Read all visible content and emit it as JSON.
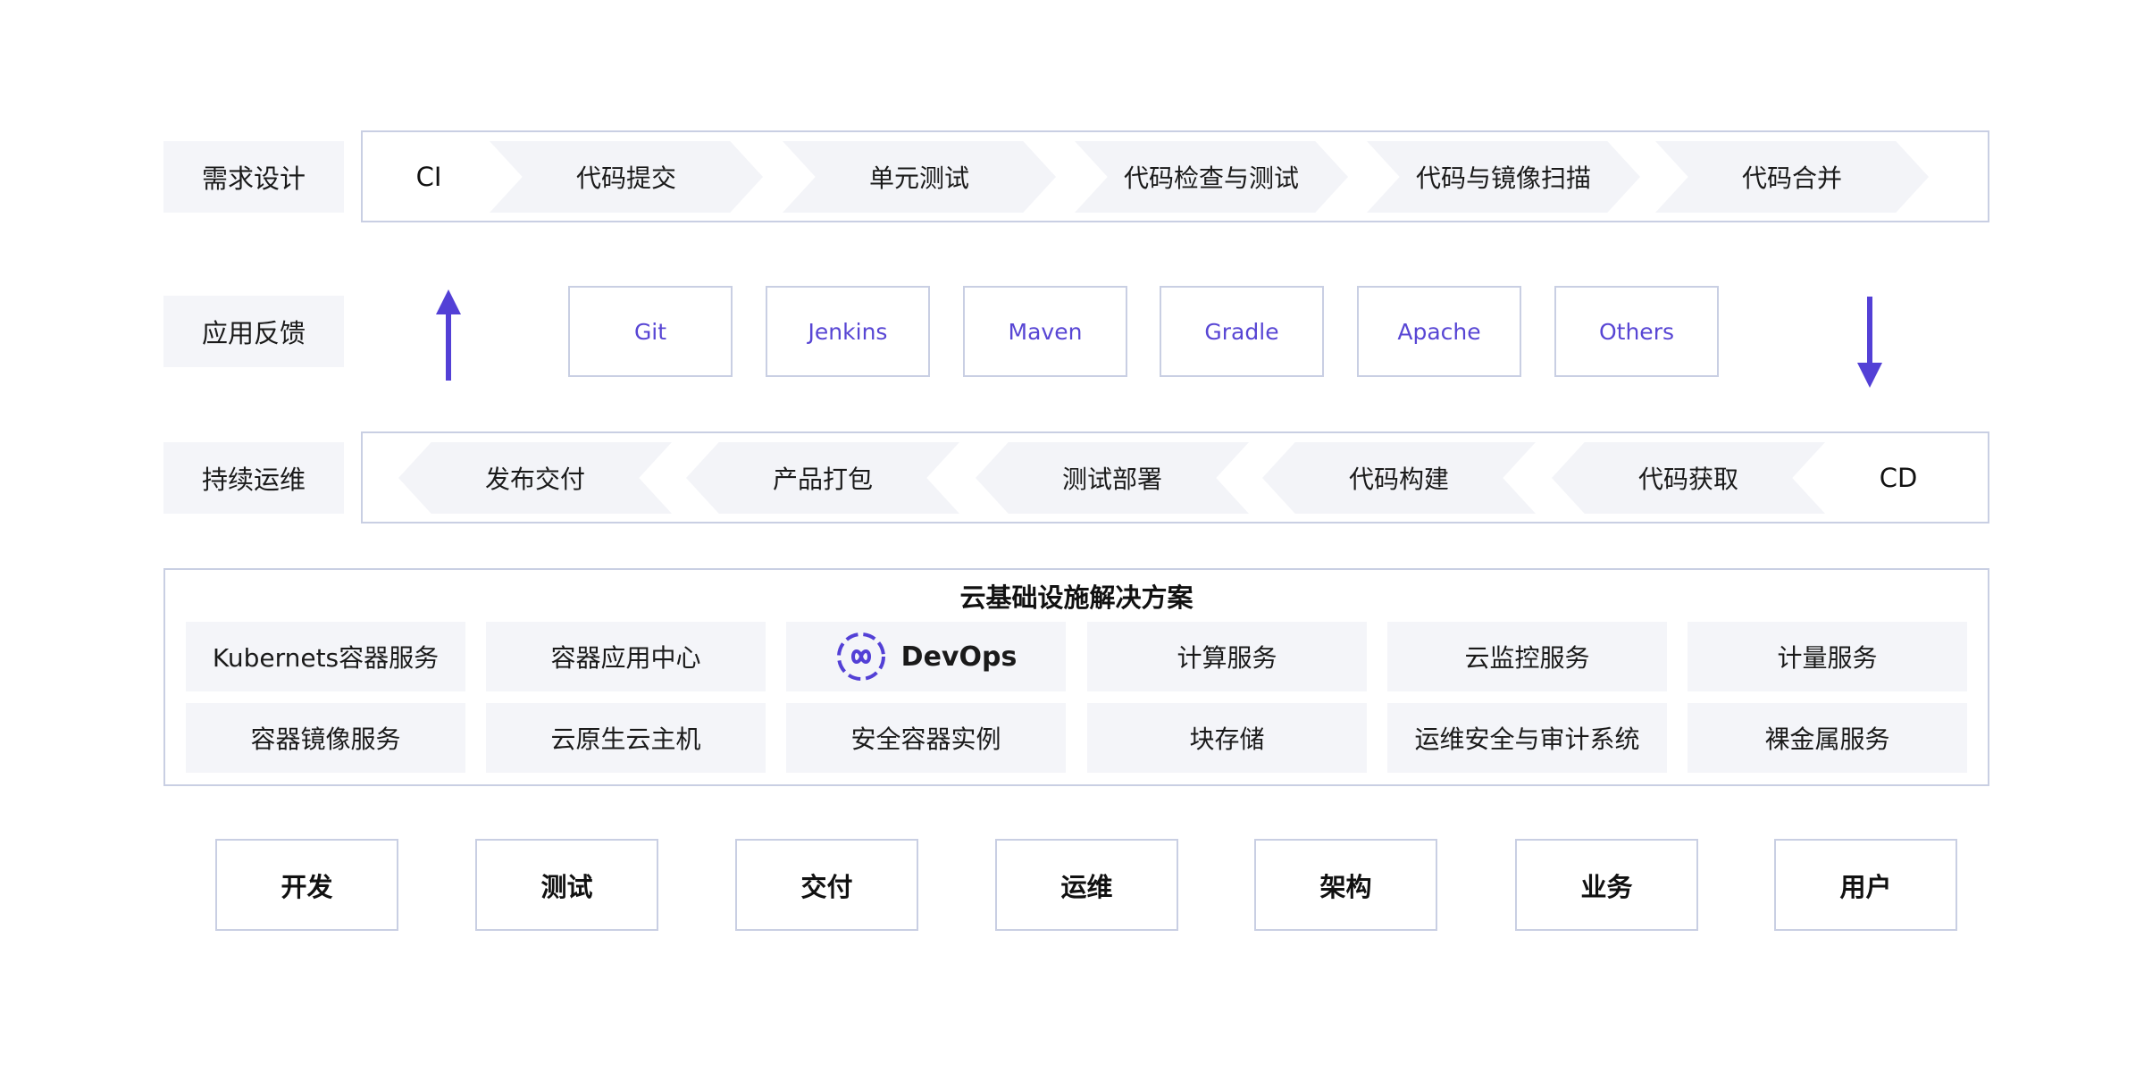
{
  "side_labels": [
    "需求设计",
    "应用反馈",
    "持续运维"
  ],
  "ci": {
    "label": "CI",
    "steps": [
      "代码提交",
      "单元测试",
      "代码检查与测试",
      "代码与镜像扫描",
      "代码合并"
    ]
  },
  "tools": [
    "Git",
    "Jenkins",
    "Maven",
    "Gradle",
    "Apache",
    "Others"
  ],
  "cd": {
    "label": "CD",
    "steps": [
      "发布交付",
      "产品打包",
      "测试部署",
      "代码构建",
      "代码获取"
    ]
  },
  "infra": {
    "title": "云基础设施解决方案",
    "row1": [
      "Kubernets容器服务",
      "容器应用中心",
      "DevOps",
      "计算服务",
      "云监控服务",
      "计量服务"
    ],
    "row2": [
      "容器镜像服务",
      "云原生云主机",
      "安全容器实例",
      "块存储",
      "运维安全与审计系统",
      "裸金属服务"
    ],
    "devops_icon": "devops-loop-icon"
  },
  "roles": [
    "开发",
    "测试",
    "交付",
    "运维",
    "架构",
    "业务",
    "用户"
  ],
  "colors": {
    "accent": "#5340d6",
    "border": "#c9cfe3",
    "cell_bg": "#f4f5f9"
  }
}
